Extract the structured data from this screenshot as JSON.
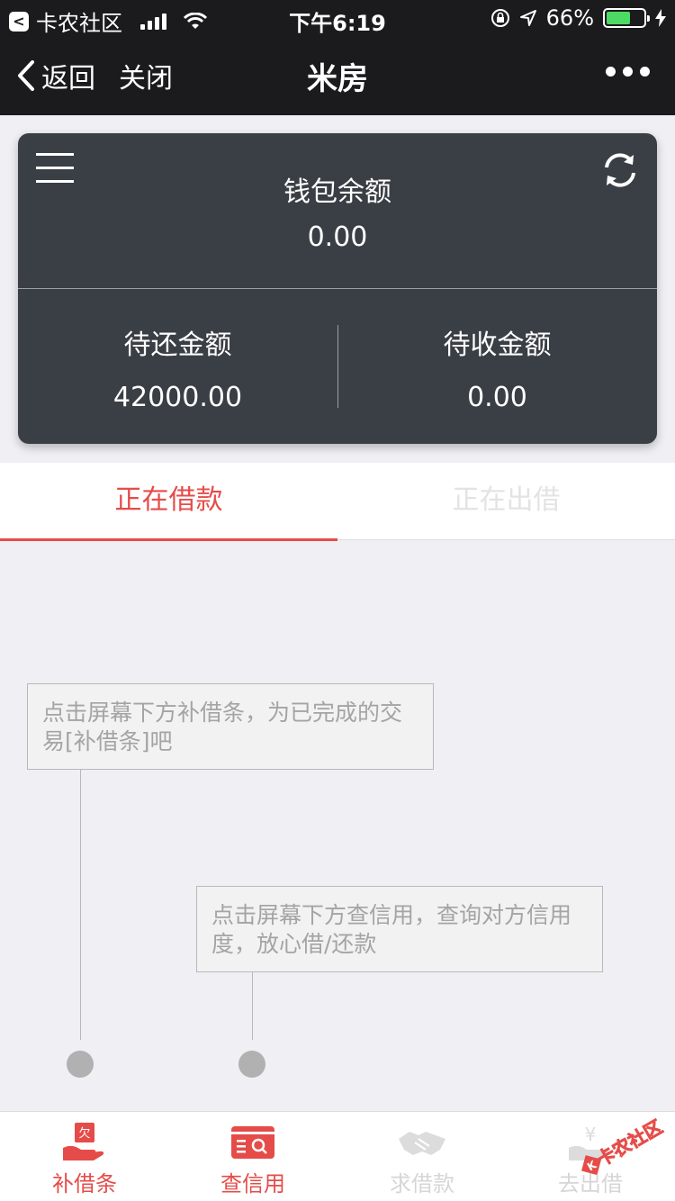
{
  "status_bar": {
    "back_app": "卡农社区",
    "time": "下午6:19",
    "battery_percent": "66%",
    "battery_level": 0.66
  },
  "nav": {
    "back_label": "返回",
    "close_label": "关闭",
    "title": "米房"
  },
  "wallet": {
    "balance_label": "钱包余额",
    "balance_value": "0.00",
    "to_repay_label": "待还金额",
    "to_repay_value": "42000.00",
    "to_receive_label": "待收金额",
    "to_receive_value": "0.00"
  },
  "tabs": [
    {
      "label": "正在借款",
      "active": true
    },
    {
      "label": "正在出借",
      "active": false
    }
  ],
  "hints": [
    "点击屏幕下方补借条，为已完成的交易[补借条]吧",
    "点击屏幕下方查信用，查询对方信用度，放心借/还款"
  ],
  "bottom_nav": [
    {
      "label": "补借条",
      "icon": "iou-hand-icon",
      "icon_char": "欠",
      "state": "active"
    },
    {
      "label": "查信用",
      "icon": "credit-search-icon",
      "state": "active"
    },
    {
      "label": "求借款",
      "icon": "handshake-icon",
      "state": "disabled"
    },
    {
      "label": "去出借",
      "icon": "yen-hand-icon",
      "state": "disabled"
    }
  ],
  "colors": {
    "accent": "#e54c49",
    "card_bg": "#3a3f45",
    "nav_bg": "#1b1b1d"
  }
}
